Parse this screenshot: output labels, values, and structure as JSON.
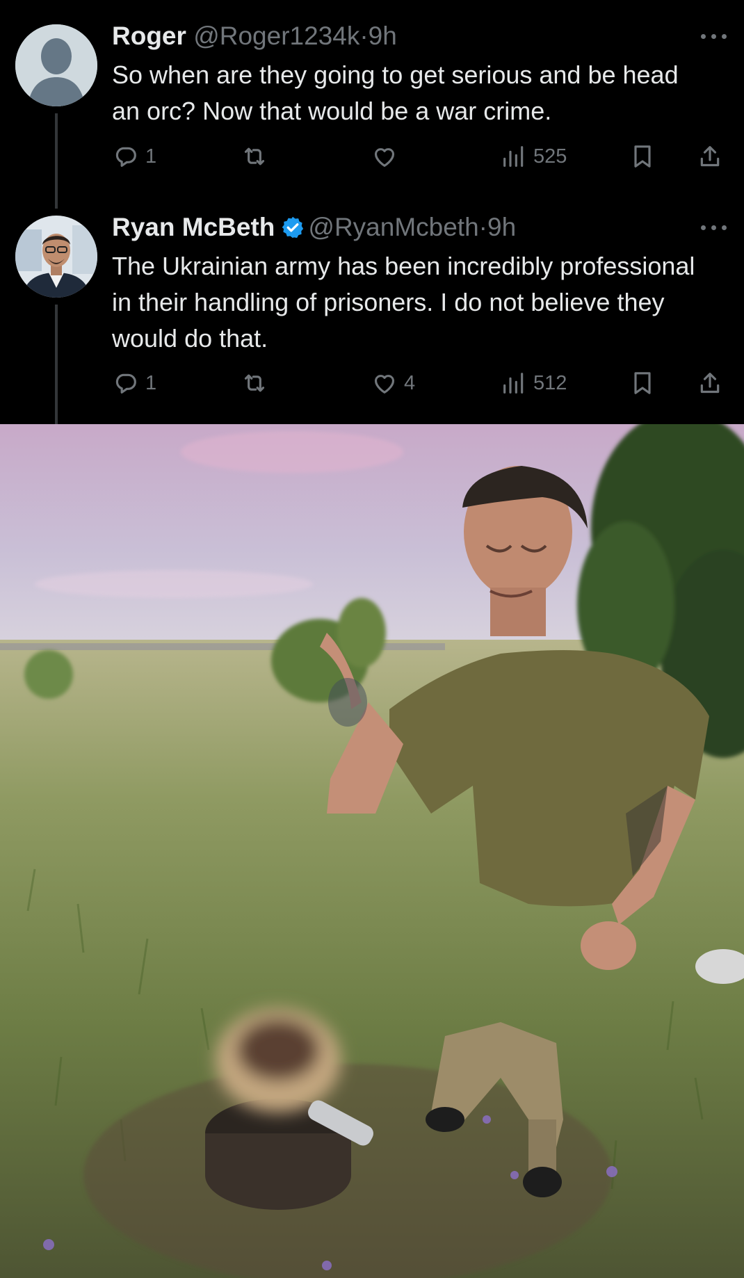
{
  "tweets": [
    {
      "name": "Roger",
      "handle": "@Roger1234k",
      "separator": "·",
      "time": "9h",
      "text": "So when are they going to get serious and be head an orc? Now that would be a war crime.",
      "replies": "1",
      "retweets": "",
      "likes": "",
      "views": "525",
      "verified": false
    },
    {
      "name": "Ryan McBeth",
      "handle": "@RyanMcbeth",
      "separator": "·",
      "time": "9h",
      "text": "The Ukrainian army has been incredibly professional in their handling of prisoners. I do not believe they would do that.",
      "replies": "1",
      "retweets": "",
      "likes": "4",
      "views": "512",
      "verified": true
    }
  ],
  "colors": {
    "background": "#000000",
    "text": "#e7e9ea",
    "muted": "#71767b",
    "verified": "#1d9bf0"
  },
  "icons": [
    "reply-icon",
    "retweet-icon",
    "like-icon",
    "views-icon",
    "bookmark-icon",
    "share-icon",
    "more-icon",
    "verified-badge-icon"
  ]
}
